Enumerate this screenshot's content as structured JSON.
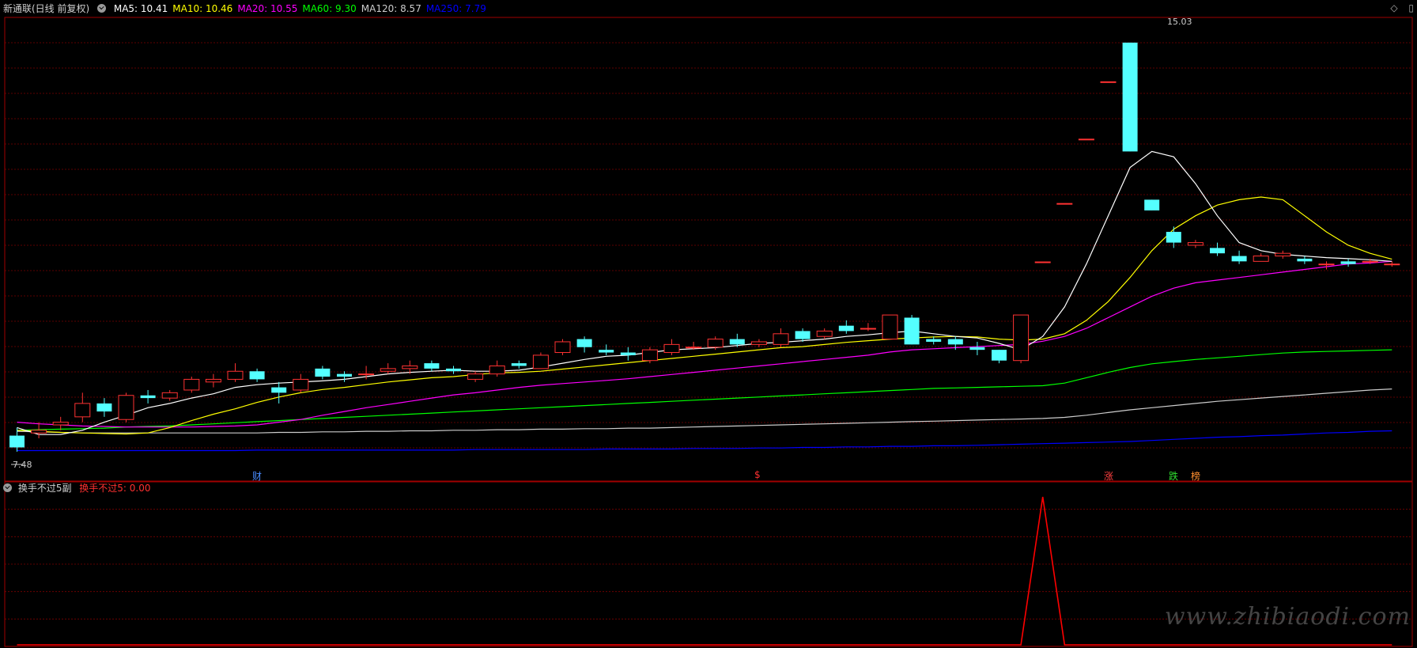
{
  "header": {
    "stock_title": "新通联(日线 前复权)",
    "ma_items": [
      {
        "label": "MA5: 10.41",
        "color": "#ffffff"
      },
      {
        "label": "MA10: 10.46",
        "color": "#ffff00"
      },
      {
        "label": "MA20: 10.55",
        "color": "#ff00ff"
      },
      {
        "label": "MA60: 9.30",
        "color": "#00ff00"
      },
      {
        "label": "MA120: 8.57",
        "color": "#cccccc"
      },
      {
        "label": "MA250: 7.79",
        "color": "#0000ff"
      }
    ]
  },
  "toolbar": {
    "diamond_icon": "◇",
    "restore_icon": "▯"
  },
  "main_chart": {
    "high_label": "15.03",
    "low_label": "7.48",
    "event_tags": [
      {
        "text": "财",
        "color": "#4a8cff"
      },
      {
        "text": "$",
        "color": "#ff3030"
      },
      {
        "text": "涨",
        "color": "#ff4040"
      },
      {
        "text": "跌",
        "color": "#30e030"
      },
      {
        "text": "榜",
        "color": "#ff9030"
      }
    ]
  },
  "sub_chart": {
    "indicator_name": "换手不过5副",
    "value_label": "换手不过5: 0.00"
  },
  "watermark": "www.zhibiaodi.com",
  "colors": {
    "up": "#ff3232",
    "down": "#54ffff",
    "grid": "#7a0000",
    "frame": "#a00000",
    "ma5": "#ffffff",
    "ma10": "#ffff00",
    "ma20": "#ff00ff",
    "ma60": "#00ff00",
    "ma120": "#cccccc",
    "ma250": "#0000ff",
    "indicator": "#ff0000"
  },
  "chart_data": {
    "type": "candlestick",
    "price_range": [
      7.0,
      15.5
    ],
    "candles": [
      [
        7.7,
        7.48,
        7.85,
        7.4
      ],
      [
        7.75,
        7.8,
        7.95,
        7.65
      ],
      [
        7.9,
        7.95,
        8.05,
        7.8
      ],
      [
        8.05,
        8.3,
        8.5,
        7.95
      ],
      [
        8.3,
        8.15,
        8.4,
        8.05
      ],
      [
        8.0,
        8.45,
        8.5,
        7.95
      ],
      [
        8.45,
        8.4,
        8.55,
        8.3
      ],
      [
        8.4,
        8.5,
        8.55,
        8.35
      ],
      [
        8.55,
        8.75,
        8.8,
        8.5
      ],
      [
        8.7,
        8.75,
        8.85,
        8.6
      ],
      [
        8.75,
        8.9,
        9.05,
        8.7
      ],
      [
        8.9,
        8.75,
        8.95,
        8.7
      ],
      [
        8.6,
        8.5,
        8.7,
        8.3
      ],
      [
        8.55,
        8.75,
        8.85,
        8.5
      ],
      [
        8.95,
        8.8,
        9.0,
        8.75
      ],
      [
        8.85,
        8.8,
        8.9,
        8.7
      ],
      [
        8.85,
        8.85,
        9.0,
        8.75
      ],
      [
        8.9,
        8.95,
        9.05,
        8.85
      ],
      [
        8.95,
        9.0,
        9.1,
        8.85
      ],
      [
        9.05,
        8.95,
        9.1,
        8.9
      ],
      [
        8.95,
        8.9,
        9.0,
        8.85
      ],
      [
        8.75,
        8.85,
        8.9,
        8.7
      ],
      [
        8.85,
        9.0,
        9.1,
        8.8
      ],
      [
        9.05,
        9.0,
        9.1,
        8.95
      ],
      [
        8.95,
        9.2,
        9.25,
        8.95
      ],
      [
        9.25,
        9.45,
        9.5,
        9.2
      ],
      [
        9.5,
        9.35,
        9.55,
        9.25
      ],
      [
        9.3,
        9.25,
        9.4,
        9.2
      ],
      [
        9.25,
        9.2,
        9.35,
        9.1
      ],
      [
        9.1,
        9.3,
        9.35,
        9.05
      ],
      [
        9.25,
        9.4,
        9.5,
        9.2
      ],
      [
        9.35,
        9.35,
        9.45,
        9.3
      ],
      [
        9.35,
        9.5,
        9.55,
        9.3
      ],
      [
        9.5,
        9.4,
        9.6,
        9.35
      ],
      [
        9.4,
        9.45,
        9.5,
        9.35
      ],
      [
        9.4,
        9.6,
        9.7,
        9.35
      ],
      [
        9.65,
        9.5,
        9.7,
        9.45
      ],
      [
        9.55,
        9.65,
        9.7,
        9.5
      ],
      [
        9.75,
        9.65,
        9.85,
        9.6
      ],
      [
        9.7,
        9.7,
        9.8,
        9.65
      ],
      [
        9.5,
        9.95,
        9.95,
        9.5
      ],
      [
        9.9,
        9.4,
        9.95,
        9.4
      ],
      [
        9.5,
        9.45,
        9.55,
        9.4
      ],
      [
        9.5,
        9.4,
        9.55,
        9.3
      ],
      [
        9.35,
        9.3,
        9.45,
        9.2
      ],
      [
        9.3,
        9.1,
        9.3,
        9.05
      ],
      [
        9.1,
        9.95,
        9.95,
        9.05
      ],
      [
        10.94,
        10.94,
        10.94,
        10.94
      ],
      [
        12.03,
        12.03,
        12.03,
        12.03
      ],
      [
        13.23,
        13.23,
        13.23,
        13.23
      ],
      [
        14.3,
        14.3,
        14.3,
        14.3
      ],
      [
        15.03,
        13.0,
        15.03,
        13.0
      ],
      [
        12.1,
        11.9,
        12.1,
        11.9
      ],
      [
        11.5,
        11.3,
        11.6,
        11.2
      ],
      [
        11.25,
        11.3,
        11.35,
        11.2
      ],
      [
        11.2,
        11.1,
        11.3,
        11.05
      ],
      [
        11.05,
        10.95,
        11.15,
        10.9
      ],
      [
        10.95,
        11.05,
        11.1,
        10.95
      ],
      [
        11.05,
        11.1,
        11.15,
        11.0
      ],
      [
        11.0,
        10.95,
        11.05,
        10.9
      ],
      [
        10.9,
        10.9,
        10.95,
        10.8
      ],
      [
        10.95,
        10.9,
        11.0,
        10.85
      ],
      [
        10.95,
        10.95,
        11.0,
        10.9
      ],
      [
        10.9,
        10.9,
        10.95,
        10.85
      ]
    ],
    "ma5": [
      7.85,
      7.72,
      7.72,
      7.8,
      7.95,
      8.08,
      8.22,
      8.3,
      8.4,
      8.48,
      8.6,
      8.65,
      8.68,
      8.7,
      8.72,
      8.75,
      8.8,
      8.85,
      8.88,
      8.9,
      8.92,
      8.9,
      8.9,
      8.92,
      8.98,
      9.05,
      9.12,
      9.18,
      9.2,
      9.25,
      9.3,
      9.32,
      9.34,
      9.38,
      9.42,
      9.44,
      9.47,
      9.5,
      9.55,
      9.58,
      9.62,
      9.65,
      9.6,
      9.55,
      9.52,
      9.42,
      9.3,
      9.55,
      10.1,
      10.9,
      11.8,
      12.7,
      13.0,
      12.9,
      12.4,
      11.8,
      11.3,
      11.15,
      11.08,
      11.05,
      11.02,
      11.0,
      10.98,
      10.95
    ],
    "ma10": [
      7.8,
      7.78,
      7.76,
      7.75,
      7.74,
      7.73,
      7.75,
      7.85,
      7.98,
      8.1,
      8.2,
      8.32,
      8.42,
      8.5,
      8.56,
      8.6,
      8.65,
      8.7,
      8.74,
      8.78,
      8.8,
      8.84,
      8.87,
      8.88,
      8.9,
      8.94,
      8.98,
      9.02,
      9.06,
      9.1,
      9.14,
      9.18,
      9.22,
      9.26,
      9.3,
      9.34,
      9.36,
      9.4,
      9.44,
      9.47,
      9.5,
      9.52,
      9.54,
      9.55,
      9.54,
      9.5,
      9.48,
      9.5,
      9.6,
      9.85,
      10.2,
      10.65,
      11.15,
      11.55,
      11.8,
      12.0,
      12.1,
      12.15,
      12.1,
      11.8,
      11.5,
      11.25,
      11.1,
      10.99
    ],
    "ma20": [
      7.95,
      7.92,
      7.9,
      7.88,
      7.87,
      7.86,
      7.86,
      7.86,
      7.86,
      7.87,
      7.88,
      7.9,
      7.95,
      8.0,
      8.08,
      8.15,
      8.22,
      8.28,
      8.34,
      8.4,
      8.46,
      8.5,
      8.55,
      8.6,
      8.64,
      8.67,
      8.7,
      8.73,
      8.76,
      8.8,
      8.84,
      8.88,
      8.92,
      8.96,
      9.0,
      9.04,
      9.08,
      9.12,
      9.16,
      9.2,
      9.26,
      9.3,
      9.32,
      9.34,
      9.36,
      9.38,
      9.4,
      9.46,
      9.55,
      9.7,
      9.9,
      10.1,
      10.3,
      10.45,
      10.55,
      10.6,
      10.65,
      10.7,
      10.75,
      10.8,
      10.85,
      10.9,
      10.92,
      10.95
    ],
    "ma60": [
      7.8,
      7.81,
      7.82,
      7.83,
      7.84,
      7.86,
      7.87,
      7.88,
      7.9,
      7.92,
      7.94,
      7.96,
      7.98,
      8.0,
      8.02,
      8.04,
      8.06,
      8.08,
      8.1,
      8.12,
      8.14,
      8.16,
      8.18,
      8.2,
      8.22,
      8.24,
      8.26,
      8.28,
      8.3,
      8.32,
      8.34,
      8.36,
      8.38,
      8.4,
      8.42,
      8.44,
      8.46,
      8.48,
      8.5,
      8.52,
      8.54,
      8.56,
      8.58,
      8.59,
      8.6,
      8.61,
      8.62,
      8.63,
      8.68,
      8.78,
      8.88,
      8.97,
      9.04,
      9.08,
      9.12,
      9.15,
      9.18,
      9.21,
      9.24,
      9.26,
      9.27,
      9.28,
      9.29,
      9.3
    ],
    "ma120": [
      7.78,
      7.77,
      7.76,
      7.75,
      7.75,
      7.75,
      7.75,
      7.75,
      7.75,
      7.75,
      7.75,
      7.75,
      7.76,
      7.76,
      7.77,
      7.77,
      7.78,
      7.78,
      7.79,
      7.79,
      7.8,
      7.8,
      7.81,
      7.81,
      7.82,
      7.82,
      7.83,
      7.83,
      7.84,
      7.84,
      7.85,
      7.86,
      7.87,
      7.88,
      7.89,
      7.9,
      7.91,
      7.92,
      7.93,
      7.94,
      7.95,
      7.96,
      7.97,
      7.98,
      7.99,
      8.0,
      8.01,
      8.02,
      8.04,
      8.08,
      8.13,
      8.18,
      8.22,
      8.26,
      8.3,
      8.34,
      8.37,
      8.4,
      8.43,
      8.46,
      8.49,
      8.52,
      8.55,
      8.57
    ],
    "ma250": [
      7.42,
      7.42,
      7.42,
      7.42,
      7.42,
      7.42,
      7.42,
      7.42,
      7.42,
      7.42,
      7.42,
      7.43,
      7.43,
      7.43,
      7.43,
      7.43,
      7.43,
      7.43,
      7.43,
      7.43,
      7.43,
      7.44,
      7.44,
      7.44,
      7.44,
      7.44,
      7.44,
      7.45,
      7.45,
      7.45,
      7.45,
      7.46,
      7.46,
      7.46,
      7.47,
      7.47,
      7.48,
      7.48,
      7.49,
      7.49,
      7.5,
      7.5,
      7.51,
      7.51,
      7.52,
      7.53,
      7.54,
      7.55,
      7.56,
      7.57,
      7.58,
      7.59,
      7.61,
      7.63,
      7.65,
      7.67,
      7.68,
      7.7,
      7.71,
      7.73,
      7.75,
      7.76,
      7.78,
      7.79
    ],
    "indicator": [
      0,
      0,
      0,
      0,
      0,
      0,
      0,
      0,
      0,
      0,
      0,
      0,
      0,
      0,
      0,
      0,
      0,
      0,
      0,
      0,
      0,
      0,
      0,
      0,
      0,
      0,
      0,
      0,
      0,
      0,
      0,
      0,
      0,
      0,
      0,
      0,
      0,
      0,
      0,
      0,
      0,
      0,
      0,
      0,
      0,
      0,
      0,
      1,
      0,
      0,
      0,
      0,
      0,
      0,
      0,
      0,
      0,
      0,
      0,
      0,
      0,
      0,
      0,
      0
    ],
    "event_tag_candle_index": [
      11,
      34,
      50,
      53,
      54
    ]
  }
}
